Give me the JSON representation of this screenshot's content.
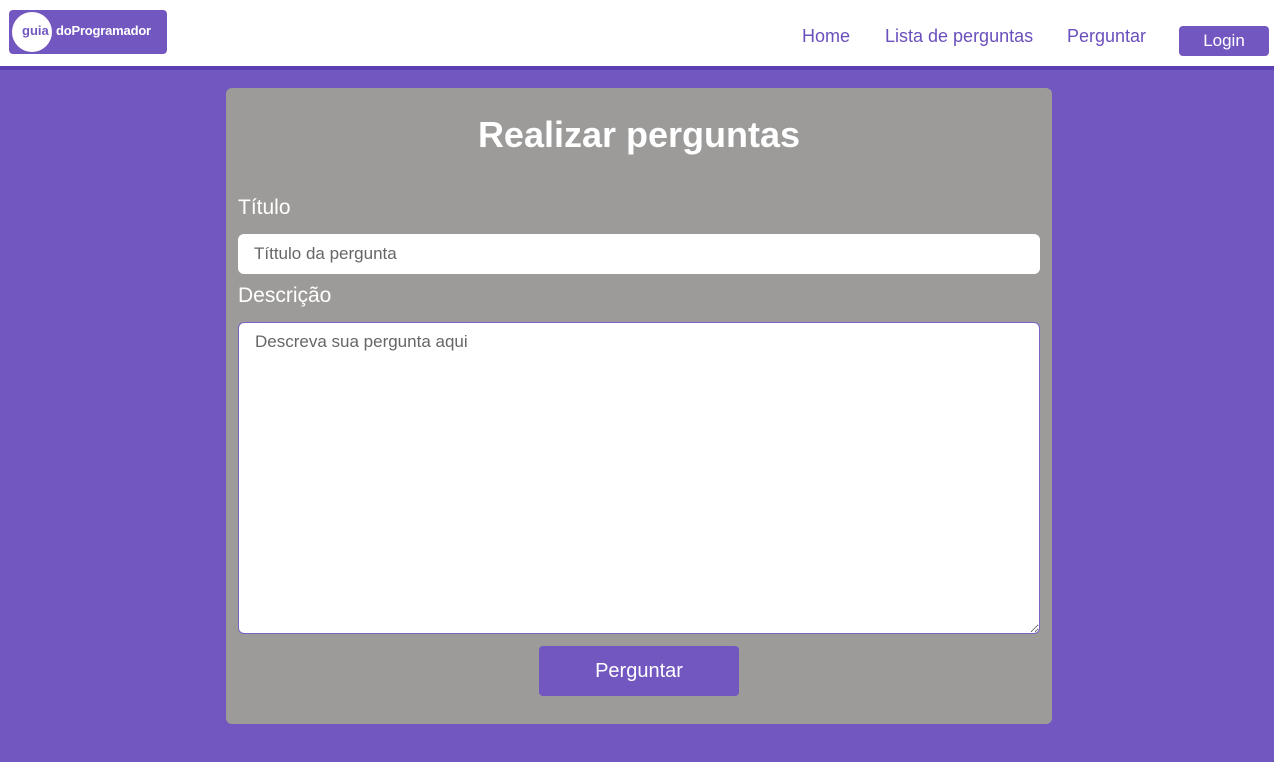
{
  "header": {
    "logo": {
      "gt": ">",
      "guia": "guia",
      "rest": "doProgramador"
    },
    "nav": [
      {
        "label": "Home"
      },
      {
        "label": "Lista de perguntas"
      },
      {
        "label": "Perguntar"
      }
    ],
    "login_label": "Login"
  },
  "form": {
    "title": "Realizar perguntas",
    "titulo_label": "Título",
    "titulo_placeholder": "Títtulo da pergunta",
    "descricao_label": "Descrição",
    "descricao_placeholder": "Descreva sua pergunta aqui",
    "submit_label": "Perguntar"
  },
  "colors": {
    "brand": "#7357c0",
    "card": "#9c9b9a",
    "header_border": "#5b3fb3"
  }
}
